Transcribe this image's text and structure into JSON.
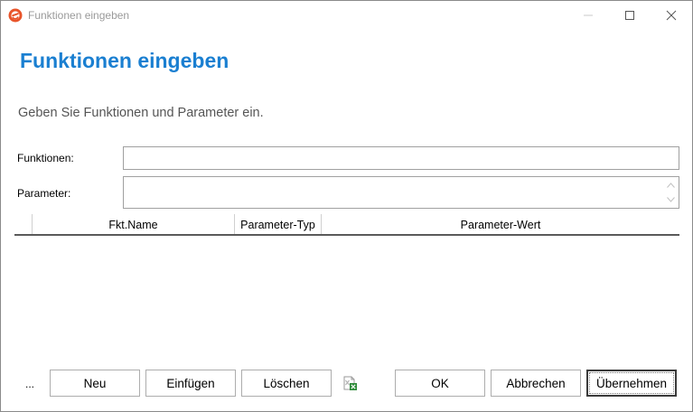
{
  "window": {
    "title": "Funktionen eingeben"
  },
  "dialog": {
    "heading": "Funktionen eingeben",
    "subtitle": "Geben Sie Funktionen und Parameter ein."
  },
  "fields": {
    "functions_label": "Funktionen:",
    "functions_value": "",
    "parameters_label": "Parameter:",
    "parameters_value": ""
  },
  "grid": {
    "columns": [
      "Fkt.Name",
      "Parameter-Typ",
      "Parameter-Wert"
    ],
    "rows": []
  },
  "buttons": {
    "more": "...",
    "new": "Neu",
    "insert": "Einfügen",
    "delete": "Löschen",
    "export_icon": "excel-export-icon",
    "ok": "OK",
    "cancel": "Abbrechen",
    "apply": "Übernehmen"
  },
  "colors": {
    "heading": "#1a7fd1",
    "app_icon": "#e8542a",
    "excel_green": "#2e8b3a"
  }
}
